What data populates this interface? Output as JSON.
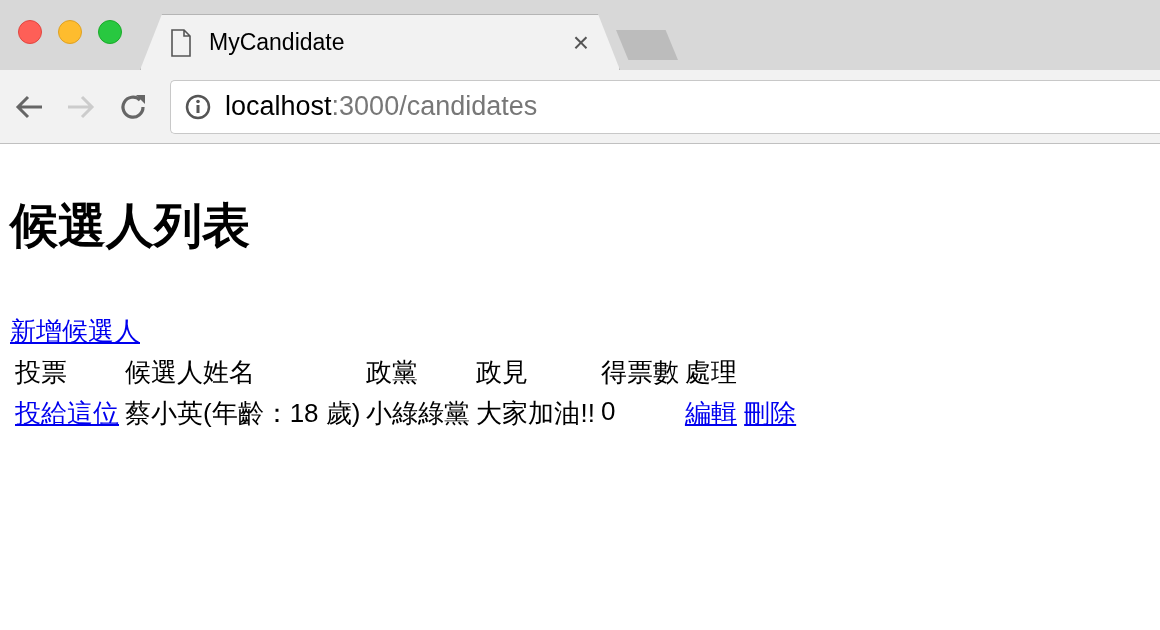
{
  "browser": {
    "tab_title": "MyCandidate",
    "tab_close": "×",
    "url_host": "localhost",
    "url_path": ":3000/candidates"
  },
  "page": {
    "heading": "候選人列表",
    "new_link": "新增候選人"
  },
  "table": {
    "columns": [
      "投票",
      "候選人姓名",
      "政黨",
      "政見",
      "得票數",
      "處理"
    ],
    "rows": [
      {
        "vote_link": "投給這位",
        "name": "蔡小英(年齡：18 歲)",
        "party": "小綠綠黨",
        "platform": "大家加油!!",
        "votes": "0",
        "edit_link": "編輯",
        "delete_link": "刪除"
      }
    ]
  }
}
